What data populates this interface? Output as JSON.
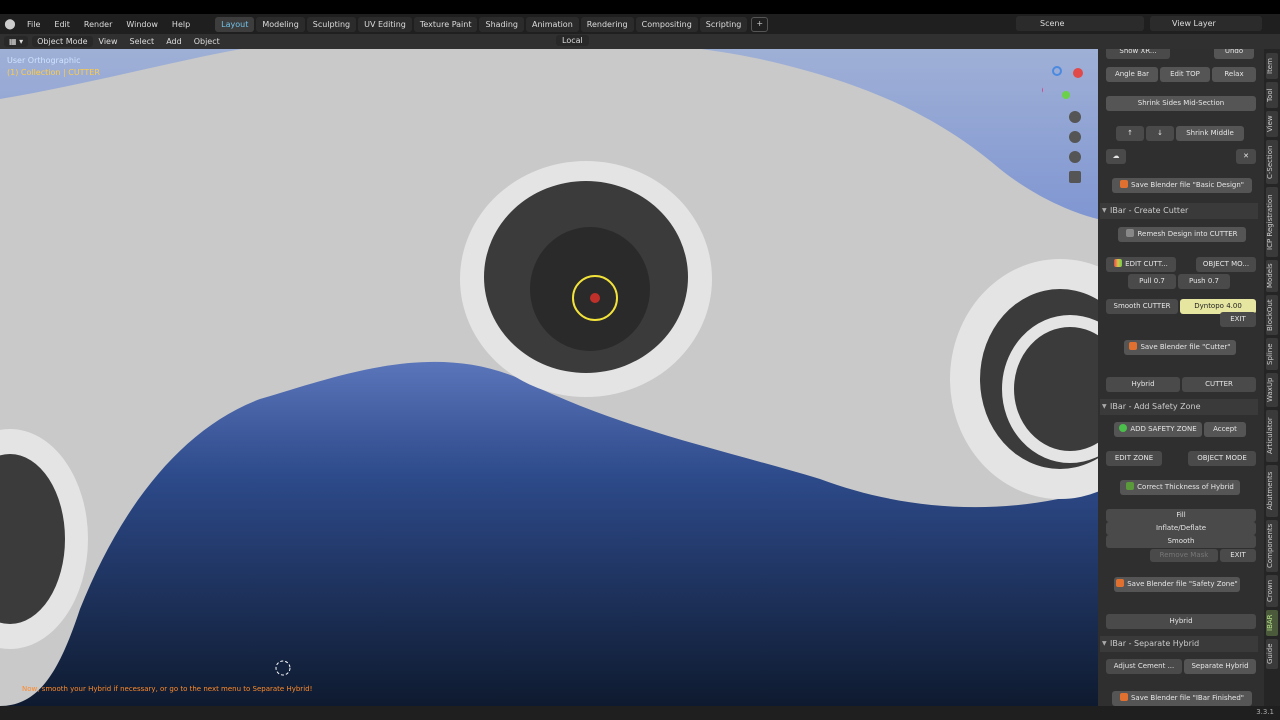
{
  "app": {
    "name": "Blender",
    "version": "3.3.1"
  },
  "menubar": {
    "items": [
      "File",
      "Edit",
      "Render",
      "Window",
      "Help"
    ]
  },
  "workspaces": {
    "tabs": [
      "Layout",
      "Modeling",
      "Sculpting",
      "UV Editing",
      "Texture Paint",
      "Shading",
      "Animation",
      "Rendering",
      "Compositing",
      "Scripting"
    ],
    "active": "Layout",
    "add_label": "+"
  },
  "scene": {
    "label": "Scene"
  },
  "view_layer": {
    "label": "View Layer"
  },
  "header": {
    "mode": "Object Mode",
    "menus": [
      "View",
      "Select",
      "Add",
      "Object"
    ],
    "orientation": "Local"
  },
  "viewport": {
    "view_name": "User Orthographic",
    "collection": "(1) Collection | CUTTER",
    "hint": "Now, smooth your Hybrid if necessary, or go to the next menu to Separate Hybrid!"
  },
  "sidebar": {
    "top_row": {
      "show_label": "Show XR...",
      "undo": "Undo"
    },
    "row1": [
      "Angle Bar",
      "Edit TOP",
      "Relax"
    ],
    "shrink_sides": "Shrink Sides Mid-Section",
    "shrink_middle": "Shrink Middle",
    "save_basic": "Save Blender file \"Basic Design\"",
    "create_cutter_title": "IBar - Create Cutter",
    "remesh": "Remesh Design into CUTTER",
    "edit_cutter": "EDIT CUTT...",
    "object_mode": "OBJECT MO...",
    "pull": "Pull 0.7",
    "push": "Push 0.7",
    "smooth_cutter": "Smooth CUTTER",
    "dyntopo_label": "Dyntopo",
    "dyntopo_value": "4.00",
    "exit": "EXIT",
    "save_cutter": "Save Blender file \"Cutter\"",
    "hybrid": "Hybrid",
    "cutter": "CUTTER",
    "safety_title": "IBar - Add Safety Zone",
    "add_safety": "ADD SAFETY ZONE",
    "accept": "Accept",
    "edit_zone": "EDIT ZONE",
    "object_mode2": "OBJECT MODE",
    "correct_thickness": "Correct Thickness of Hybrid",
    "fill": "Fill",
    "inflate": "Inflate/Deflate",
    "smooth": "Smooth",
    "remove_mask": "Remove Mask",
    "exit2": "EXIT",
    "save_safety": "Save Blender file \"Safety Zone\"",
    "hybrid2": "Hybrid",
    "separate_title": "IBar - Separate Hybrid",
    "adjust_cement": "Adjust Cement ...",
    "separate_hybrid": "Separate Hybrid",
    "save_finished": "Save Blender file \"IBar Finished\""
  },
  "right_tabs": [
    "Item",
    "Tool",
    "View",
    "C-Section",
    "ICP Registration",
    "Models",
    "BlockOut",
    "Spline",
    "WaxUp",
    "Articulator",
    "Abutments",
    "Components",
    "Crown",
    "IBAR",
    "Guide"
  ],
  "right_tabs_active": "IBAR",
  "colors": {
    "accent": "#71c2e8",
    "save_icon": "#e07030",
    "hint": "#ff8a2a",
    "collection_text": "#ffcc44"
  }
}
